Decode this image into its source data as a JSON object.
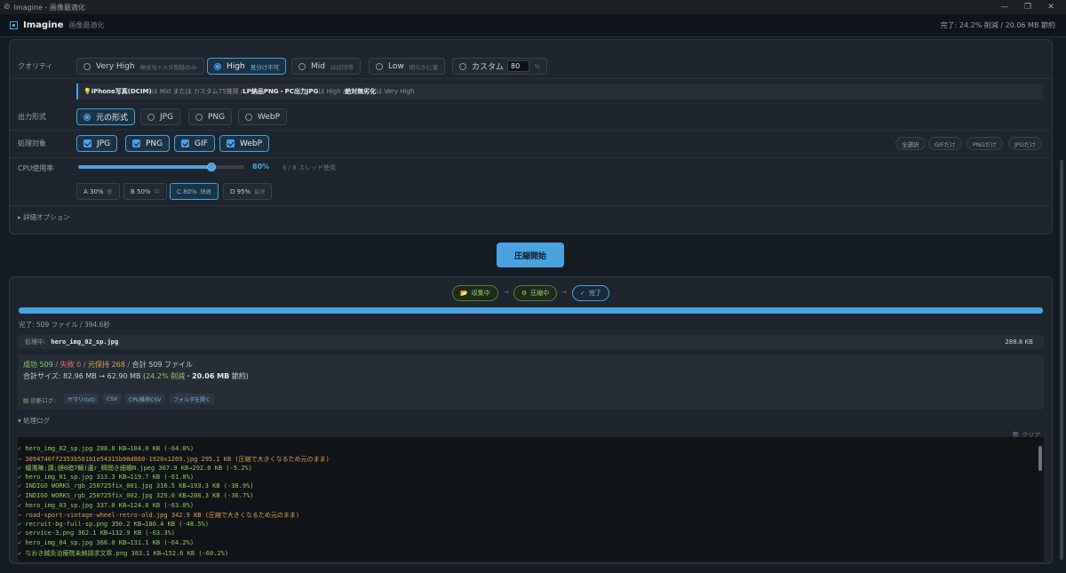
{
  "window": {
    "title": "Imagine - 画像最適化"
  },
  "header": {
    "app_name": "Imagine",
    "app_sub": "画像最適化",
    "status": "完了: 24.2% 削減 / 20.06 MB 節約"
  },
  "quality": {
    "label": "クオリティ",
    "options": [
      {
        "label": "Very High",
        "sub": "無劣化+メタ削除のみ"
      },
      {
        "label": "High",
        "sub": "見分け不可"
      },
      {
        "label": "Mid",
        "sub": "ほぼ同等"
      },
      {
        "label": "Low",
        "sub": "明らかに差"
      }
    ],
    "selected": "High",
    "custom_label": "カスタム",
    "custom_value": "80",
    "custom_unit": "%",
    "hint": {
      "lead": "💡 ",
      "a": "iPhone写真(DCIM)",
      "t1": " は Mid または カスタム75推奨 / ",
      "b": "LP納品PNG・PC出力JPG",
      "t2": " は High / ",
      "c": "絶対無劣化",
      "t3": " は Very High"
    }
  },
  "output": {
    "label": "出力形式",
    "options": [
      "元の形式",
      "JPG",
      "PNG",
      "WebP"
    ],
    "selected": "元の形式"
  },
  "targets": {
    "label": "処理対象",
    "options": [
      "JPG",
      "PNG",
      "GIF",
      "WebP"
    ],
    "quick": [
      "全選択",
      "GIFだけ",
      "PNGだけ",
      "JPGだけ"
    ]
  },
  "cpu": {
    "label": "CPU使用率",
    "value": 0.8,
    "value_text": "80%",
    "threads_text": "6 / 8 スレッド使用",
    "presets": [
      {
        "label": "A 30%",
        "sub": "軽"
      },
      {
        "label": "B 50%",
        "sub": "中"
      },
      {
        "label": "C 80%",
        "sub": "快適"
      },
      {
        "label": "D 95%",
        "sub": "最速"
      }
    ],
    "selected_preset": "C 80%"
  },
  "advanced": {
    "label": "▸ 詳細オプション"
  },
  "start_button": "圧縮開始",
  "stages": [
    {
      "icon": "📂",
      "label": "収集中"
    },
    {
      "icon": "⚙",
      "label": "圧縮中"
    },
    {
      "icon": "✓",
      "label": "完了"
    }
  ],
  "progress": {
    "value": 1.0,
    "text": "完了: 509 ファイル / 394.6秒"
  },
  "current": {
    "label": "処理中:",
    "file": "hero_img_02_sp.jpg",
    "size": "288.8 KB"
  },
  "summary": {
    "success": "成功 509",
    "fail": "失敗 0",
    "kept": "元保持 268",
    "total": "合計 509 ファイル",
    "size_prefix": "合計サイズ: 82.96 MB → 62.90 MB (",
    "size_pct": "24.2% 削減",
    "size_mid": "・",
    "size_saved": "20.06 MB",
    "size_suffix": " 節約)",
    "diag_label": "診断ログ:",
    "links": [
      "サマリ(txt)",
      "CSV",
      "CPU推移CSV",
      "フォルダを開く"
    ]
  },
  "log": {
    "header": "▾ 処理ログ",
    "clear": "🗑 クリア",
    "lines": [
      {
        "s": "ok",
        "t": "✓ hero_img_02_sp.jpg 288.8 KB→104.0 KB (-64.0%)"
      },
      {
        "s": "warn",
        "t": "− 3094746ff2353b501b1e5431Sb90d860-1920x1269.jpg 295.1 KB (圧縮で大きくなるため元のまま)"
      },
      {
        "s": "ok",
        "t": "✓ 蟻濁陳;講;鏈0暗7輌)邊r_瞬閲き細蛾N.jpeg 307.9 KB→292.0 KB (-5.2%)"
      },
      {
        "s": "ok",
        "t": "✓ hero_img_01_sp.jpg 313.3 KB→119.7 KB (-61.8%)"
      },
      {
        "s": "ok",
        "t": "✓ INDIGO WORKS_rgb_250725fix_001.jpg 316.5 KB→193.3 KB (-38.9%)"
      },
      {
        "s": "ok",
        "t": "✓ INDIGO WORKS_rgb_250725fix_002.jpg 329.0 KB→208.3 KB (-36.7%)"
      },
      {
        "s": "ok",
        "t": "✓ hero_img_03_sp.jpg 337.0 KB→124.8 KB (-63.0%)"
      },
      {
        "s": "warn",
        "t": "− road-sport-vintage-wheel-retro-old.jpg 342.9 KB (圧縮で大きくなるため元のまま)"
      },
      {
        "s": "ok",
        "t": "✓ recruit-bg-full-sp.png 350.2 KB→180.4 KB (-48.5%)"
      },
      {
        "s": "ok",
        "t": "✓ service-3.png 362.1 KB→132.9 KB (-63.3%)"
      },
      {
        "s": "ok",
        "t": "✓ hero_img_04_sp.jpg 366.0 KB→131.1 KB (-64.2%)"
      },
      {
        "s": "ok",
        "t": "✓ なおき鍼灸治療院未納請求文章.png 383.1 KB→152.6 KB (-60.2%)"
      }
    ]
  }
}
